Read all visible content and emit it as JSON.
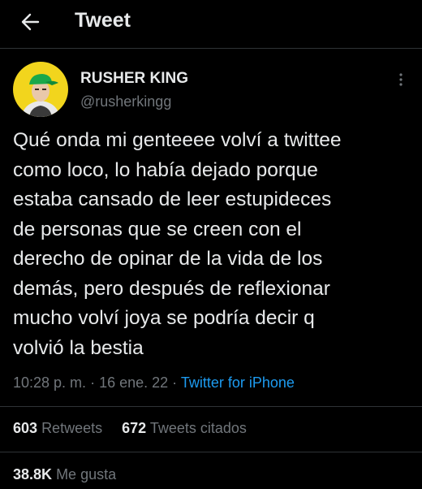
{
  "header": {
    "title": "Tweet",
    "back_icon": "back-arrow-icon"
  },
  "author": {
    "display_name": "RUSHER KING",
    "handle": "@rusherkingg",
    "avatar_colors": {
      "background": "#f2d51d",
      "cap": "#1aa84a",
      "skin": "#e9c8aa"
    }
  },
  "more_icon": "more-vertical-icon",
  "tweet": {
    "text": "Qué onda mi genteeee volví a twittee\ncomo loco, lo había dejado porque\nestaba cansado de leer estupideces\nde personas que se creen con el\nderecho de opinar de la vida de los\ndemás, pero después de reflexionar\nmucho volví joya se podría decir q\nvolvió la bestia"
  },
  "meta": {
    "time": "10:28 p. m.",
    "separator": " · ",
    "date": "16 ene. 22",
    "source": "Twitter for iPhone"
  },
  "stats": {
    "retweets_count": "603",
    "retweets_label": "Retweets",
    "quotes_count": "672",
    "quotes_label": "Tweets citados",
    "likes_count": "38.8K",
    "likes_label": "Me gusta"
  },
  "colors": {
    "background": "#000000",
    "text": "#e7e9ea",
    "secondary": "#71767b",
    "link": "#1d9bf0",
    "divider": "#2f3336"
  }
}
